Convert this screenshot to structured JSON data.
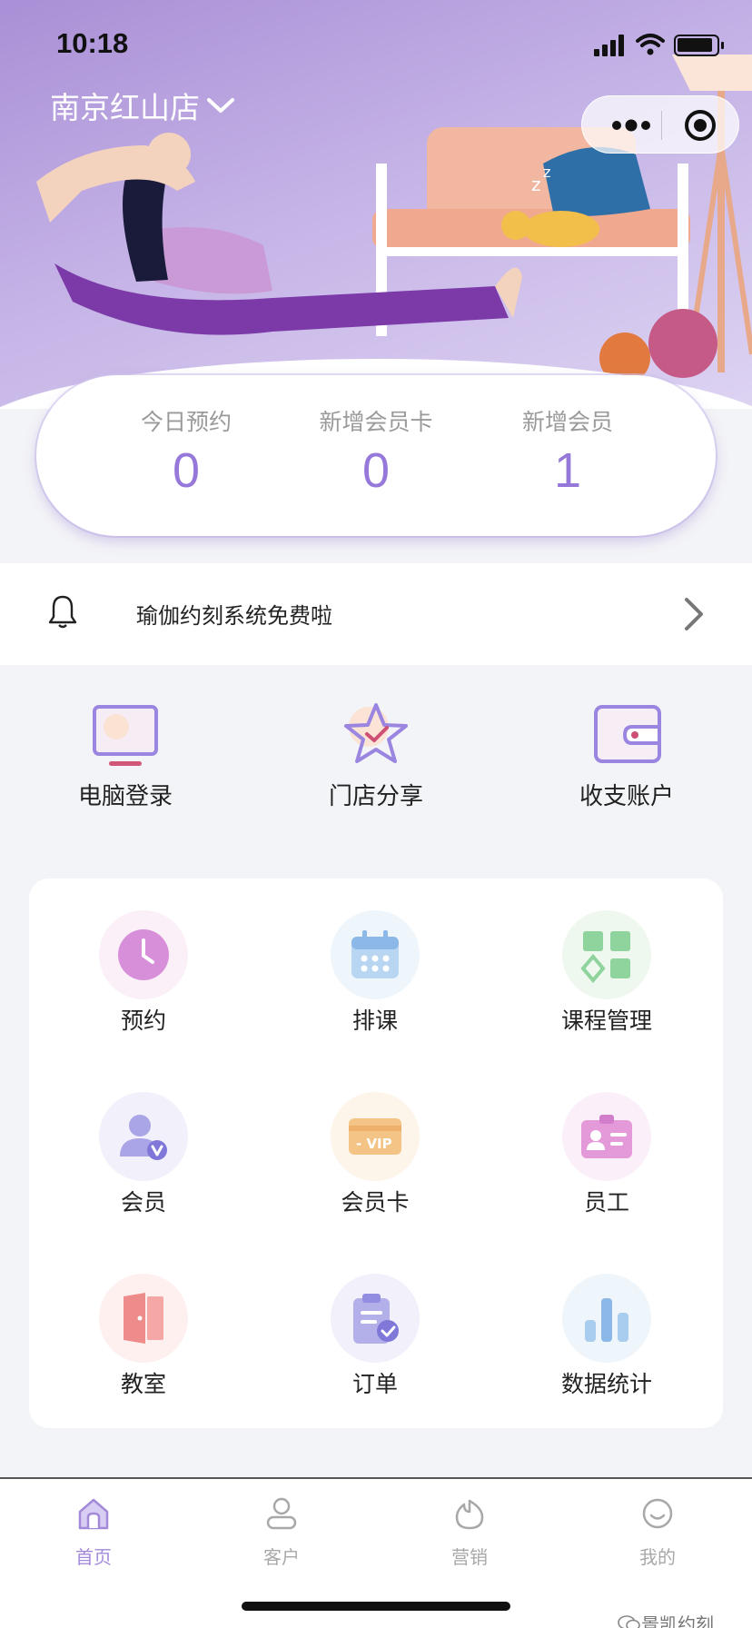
{
  "status_bar": {
    "time": "10:18"
  },
  "header": {
    "store_name": "南京红山店"
  },
  "stats": [
    {
      "label": "今日预约",
      "value": "0"
    },
    {
      "label": "新增会员卡",
      "value": "0"
    },
    {
      "label": "新增会员",
      "value": "1"
    }
  ],
  "notice": {
    "text": "瑜伽约刻系统免费啦"
  },
  "quick_actions": [
    {
      "label": "电脑登录",
      "icon": "monitor-icon"
    },
    {
      "label": "门店分享",
      "icon": "star-icon"
    },
    {
      "label": "收支账户",
      "icon": "wallet-icon"
    }
  ],
  "grid": [
    {
      "label": "预约",
      "icon": "clock-icon"
    },
    {
      "label": "排课",
      "icon": "calendar-icon"
    },
    {
      "label": "课程管理",
      "icon": "course-blocks-icon"
    },
    {
      "label": "会员",
      "icon": "member-icon"
    },
    {
      "label": "会员卡",
      "icon": "vip-card-icon"
    },
    {
      "label": "员工",
      "icon": "staff-badge-icon"
    },
    {
      "label": "教室",
      "icon": "door-icon"
    },
    {
      "label": "订单",
      "icon": "clipboard-icon"
    },
    {
      "label": "数据统计",
      "icon": "bar-chart-icon"
    }
  ],
  "tabs": [
    {
      "label": "首页",
      "icon": "home-icon",
      "active": true
    },
    {
      "label": "客户",
      "icon": "user-icon",
      "active": false
    },
    {
      "label": "营销",
      "icon": "marketing-icon",
      "active": false
    },
    {
      "label": "我的",
      "icon": "smile-icon",
      "active": false
    }
  ],
  "watermark": "景凯约刻",
  "colors": {
    "accent": "#9578d9",
    "hero_top": "#a98fd6"
  }
}
